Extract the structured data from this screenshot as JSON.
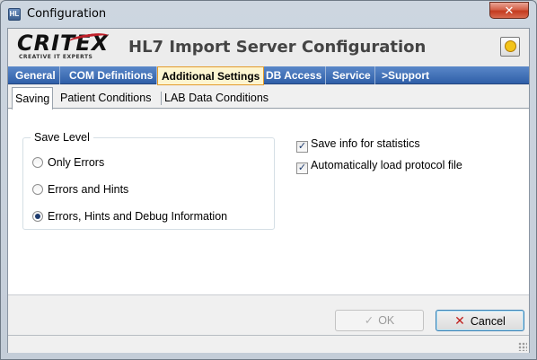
{
  "window": {
    "title": "Configuration",
    "close_label": "✕"
  },
  "header": {
    "logo_word": "CRITEX",
    "logo_sub": "CREATIVE IT EXPERTS",
    "title": "HL7 Import Server Configuration",
    "help_icon": "help-icon"
  },
  "main_tabs": [
    {
      "label": "General",
      "active": false
    },
    {
      "label": "COM Definitions",
      "active": false
    },
    {
      "label": "Additional Settings",
      "active": true
    },
    {
      "label": "DB Access",
      "active": false
    },
    {
      "label": "Service",
      "active": false
    },
    {
      "label": ">Support",
      "active": false
    }
  ],
  "sub_tabs": [
    {
      "label": "Saving",
      "active": true
    },
    {
      "label": "Patient Conditions",
      "active": false
    },
    {
      "label": "LAB Data Conditions",
      "active": false
    }
  ],
  "save_level": {
    "legend": "Save Level",
    "options": [
      {
        "label": "Only Errors",
        "checked": false
      },
      {
        "label": "Errors and Hints",
        "checked": false
      },
      {
        "label": "Errors, Hints and Debug Information",
        "checked": true
      }
    ]
  },
  "options": [
    {
      "label": "Save info for statistics",
      "checked": true
    },
    {
      "label": "Automatically load protocol file",
      "checked": true
    }
  ],
  "buttons": {
    "ok_label": "OK",
    "ok_enabled": false,
    "cancel_label": "Cancel"
  },
  "colors": {
    "tab_bar": "#2f5fa8",
    "active_tab": "#fdf5d0",
    "cancel_icon": "#c0201e"
  }
}
